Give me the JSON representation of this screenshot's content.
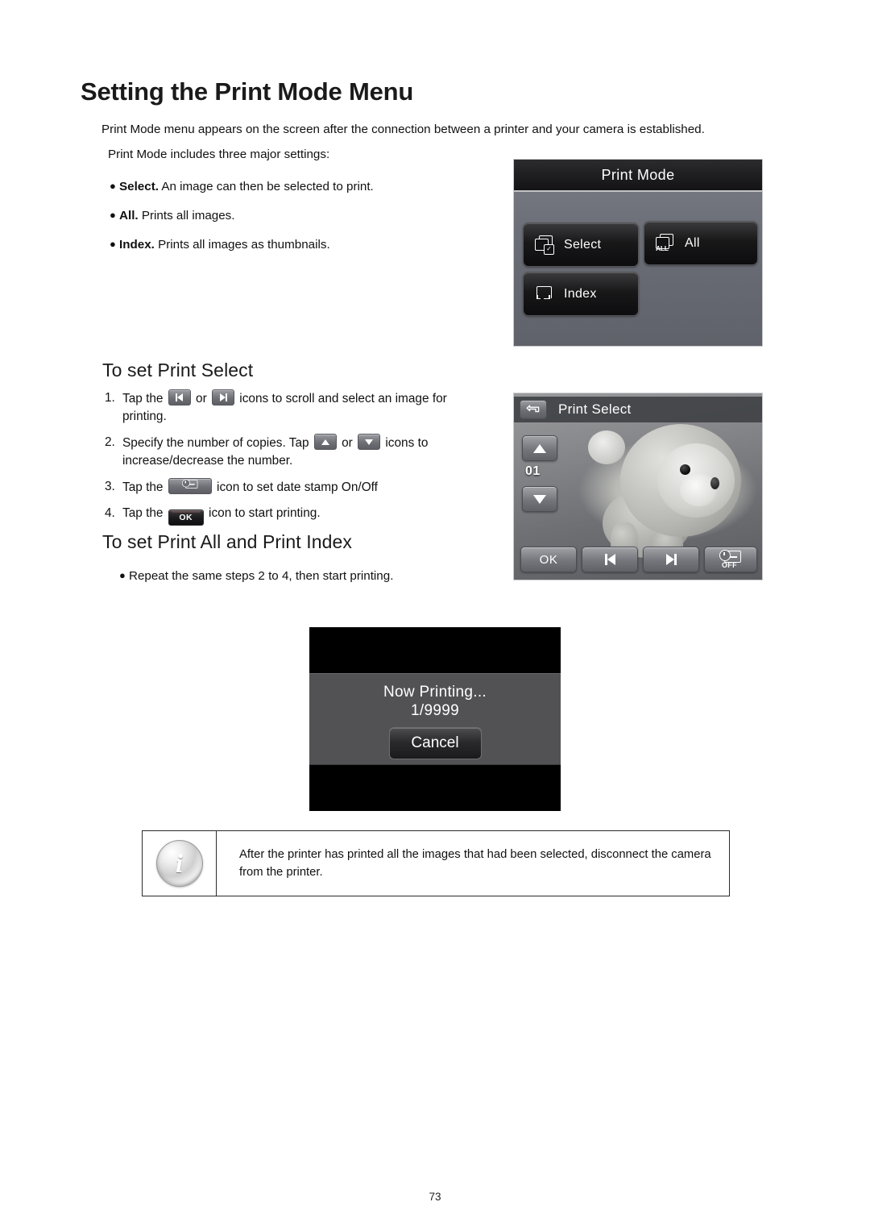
{
  "document": {
    "page_title": "Setting the Print Mode Menu",
    "page_number": "73",
    "intro_line_1": "Print Mode menu appears on the screen after the connection between a printer and your camera is established.",
    "intro_line_2": "Print Mode includes three major settings:"
  },
  "bullets": [
    {
      "term": "Select.",
      "text": " An image can then be selected to print."
    },
    {
      "term": "All.",
      "text": " Prints all images."
    },
    {
      "term": "Index.",
      "text": " Prints all images as thumbnails."
    }
  ],
  "sections": {
    "print_select_heading": "To set Print Select",
    "print_all_index_heading": "To set Print All and Print Index",
    "repeat_bullet": "Repeat the same steps 2 to 4, then start printing."
  },
  "steps": [
    {
      "number": "1.",
      "part_a": "Tap the ",
      "icon_a": "prev-image-icon",
      "part_b": " or ",
      "icon_b": "next-image-icon",
      "part_c": " icons to scroll and select an image for printing."
    },
    {
      "number": "2.",
      "part_a": "Specify the number of copies. Tap ",
      "icon_a": "increase-copies-icon",
      "part_b": " or ",
      "icon_b": "decrease-copies-icon",
      "part_c": " icons to increase/decrease the number."
    },
    {
      "number": "3.",
      "part_a": "Tap the ",
      "icon_a": "date-stamp-icon",
      "part_b": "",
      "icon_b": "",
      "part_c": " icon to set date stamp On/Off"
    },
    {
      "number": "4.",
      "part_a": "Tap the ",
      "icon_a": "ok-icon",
      "icon_a_label": "OK",
      "part_b": "",
      "icon_b": "",
      "part_c": " icon to start printing."
    }
  ],
  "print_mode_screen": {
    "title": "Print Mode",
    "buttons": [
      {
        "label": "Select",
        "icon": "pages-check-icon"
      },
      {
        "label": "All",
        "icon": "pages-all-icon"
      },
      {
        "label": "Index",
        "icon": "index-frame-icon"
      }
    ]
  },
  "print_select_screen": {
    "title": "Print Select",
    "back_icon": "back-arrow-icon",
    "copy_count": "01",
    "up_icon": "arrow-up-icon",
    "down_icon": "arrow-down-icon",
    "bottom_buttons": [
      {
        "label": "OK",
        "icon": "ok-icon"
      },
      {
        "label": "",
        "icon": "prev-image-icon"
      },
      {
        "label": "",
        "icon": "next-image-icon"
      },
      {
        "label": "OFF",
        "icon": "date-stamp-off-icon"
      }
    ],
    "photo_subject": "crocheted-lion-toy-photo"
  },
  "now_printing_screen": {
    "status": "Now Printing...",
    "progress": "1/9999",
    "cancel_label": "Cancel"
  },
  "note_box": {
    "icon": "info-icon",
    "icon_glyph": "i",
    "text": "After the printer has printed all the images that had been selected, disconnect the camera from the printer."
  },
  "colors": {
    "page_background": "#ffffff",
    "text": "#111111",
    "screen_titlebar": "#1b1b1d",
    "screen_background": "#6b6e76",
    "dialog_band": "#525254",
    "note_border": "#2b2b2b"
  }
}
